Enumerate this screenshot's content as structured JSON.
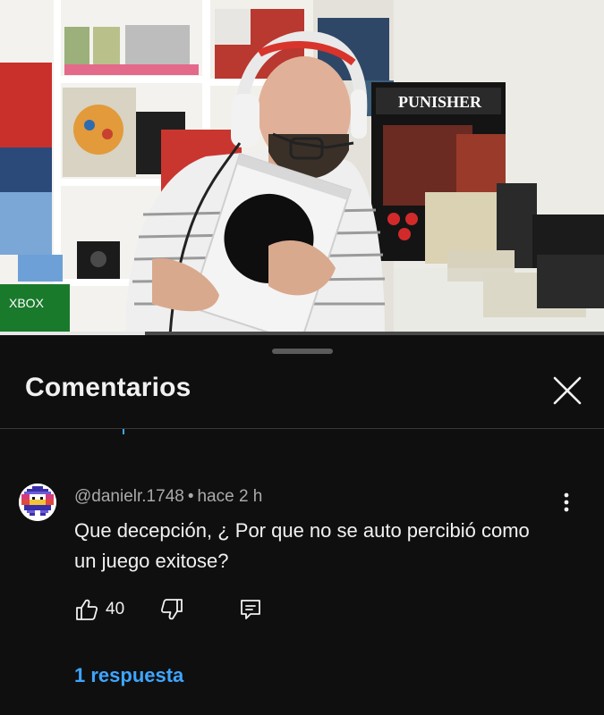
{
  "panel": {
    "title": "Comentarios",
    "close_icon": "close-icon"
  },
  "comment": {
    "author": "@danielr.1748",
    "separator": "•",
    "time": "hace 2 h",
    "text": "Que decepción, ¿ Por que no se auto percibió como un juego exitose?",
    "like_count": "40",
    "replies_label": "1 respuesta",
    "avatar_icon": "pixel-avatar"
  },
  "video": {
    "box_label": "XBOX",
    "sign_label": "PUNISHER",
    "progress": 0.24
  },
  "colors": {
    "background": "#0f0f0f",
    "text": "#f1f1f1",
    "secondary_text": "#aaaaaa",
    "link": "#3ea6ff"
  }
}
